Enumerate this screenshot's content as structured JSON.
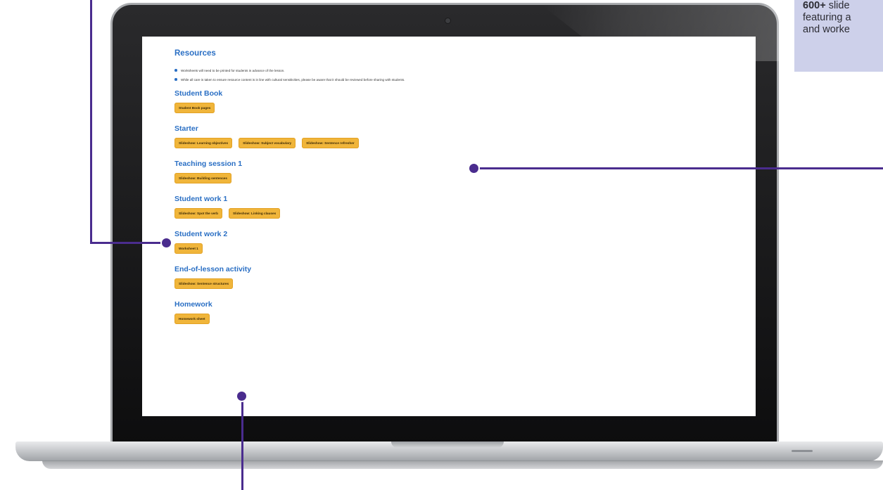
{
  "page": {
    "title": "Resources",
    "notes": [
      "Worksheets will need to be printed for students in advance of the lesson.",
      "While all care is taken to ensure resource content is in line with cultural sensitivities, please be aware that it should be reviewed before sharing with students."
    ],
    "sections": [
      {
        "title": "Student Book",
        "buttons": [
          "Student Book pages"
        ]
      },
      {
        "title": "Starter",
        "buttons": [
          "Slideshow: Learning objectives",
          "Slideshow: Subject vocabulary",
          "Slideshow: Sentence refresher"
        ]
      },
      {
        "title": "Teaching session 1",
        "buttons": [
          "Slideshow: Building sentences"
        ]
      },
      {
        "title": "Student work 1",
        "buttons": [
          "Slideshow: Spot the verb",
          "Slideshow: Linking clauses"
        ]
      },
      {
        "title": "Student work 2",
        "buttons": [
          "Worksheet 1"
        ]
      },
      {
        "title": "End-of-lesson activity",
        "buttons": [
          "Slideshow: Sentence structures"
        ]
      },
      {
        "title": "Homework",
        "buttons": [
          "Homework sheet"
        ]
      }
    ]
  },
  "callout": {
    "bold": "600+",
    "line1_rest": " slide",
    "line2": "featuring a",
    "line3": "and worke"
  },
  "colors": {
    "heading": "#2a6fc4",
    "button": "#f0b53a",
    "callout_line": "#4a2c8e",
    "callout_box": "#cdd0ea"
  }
}
